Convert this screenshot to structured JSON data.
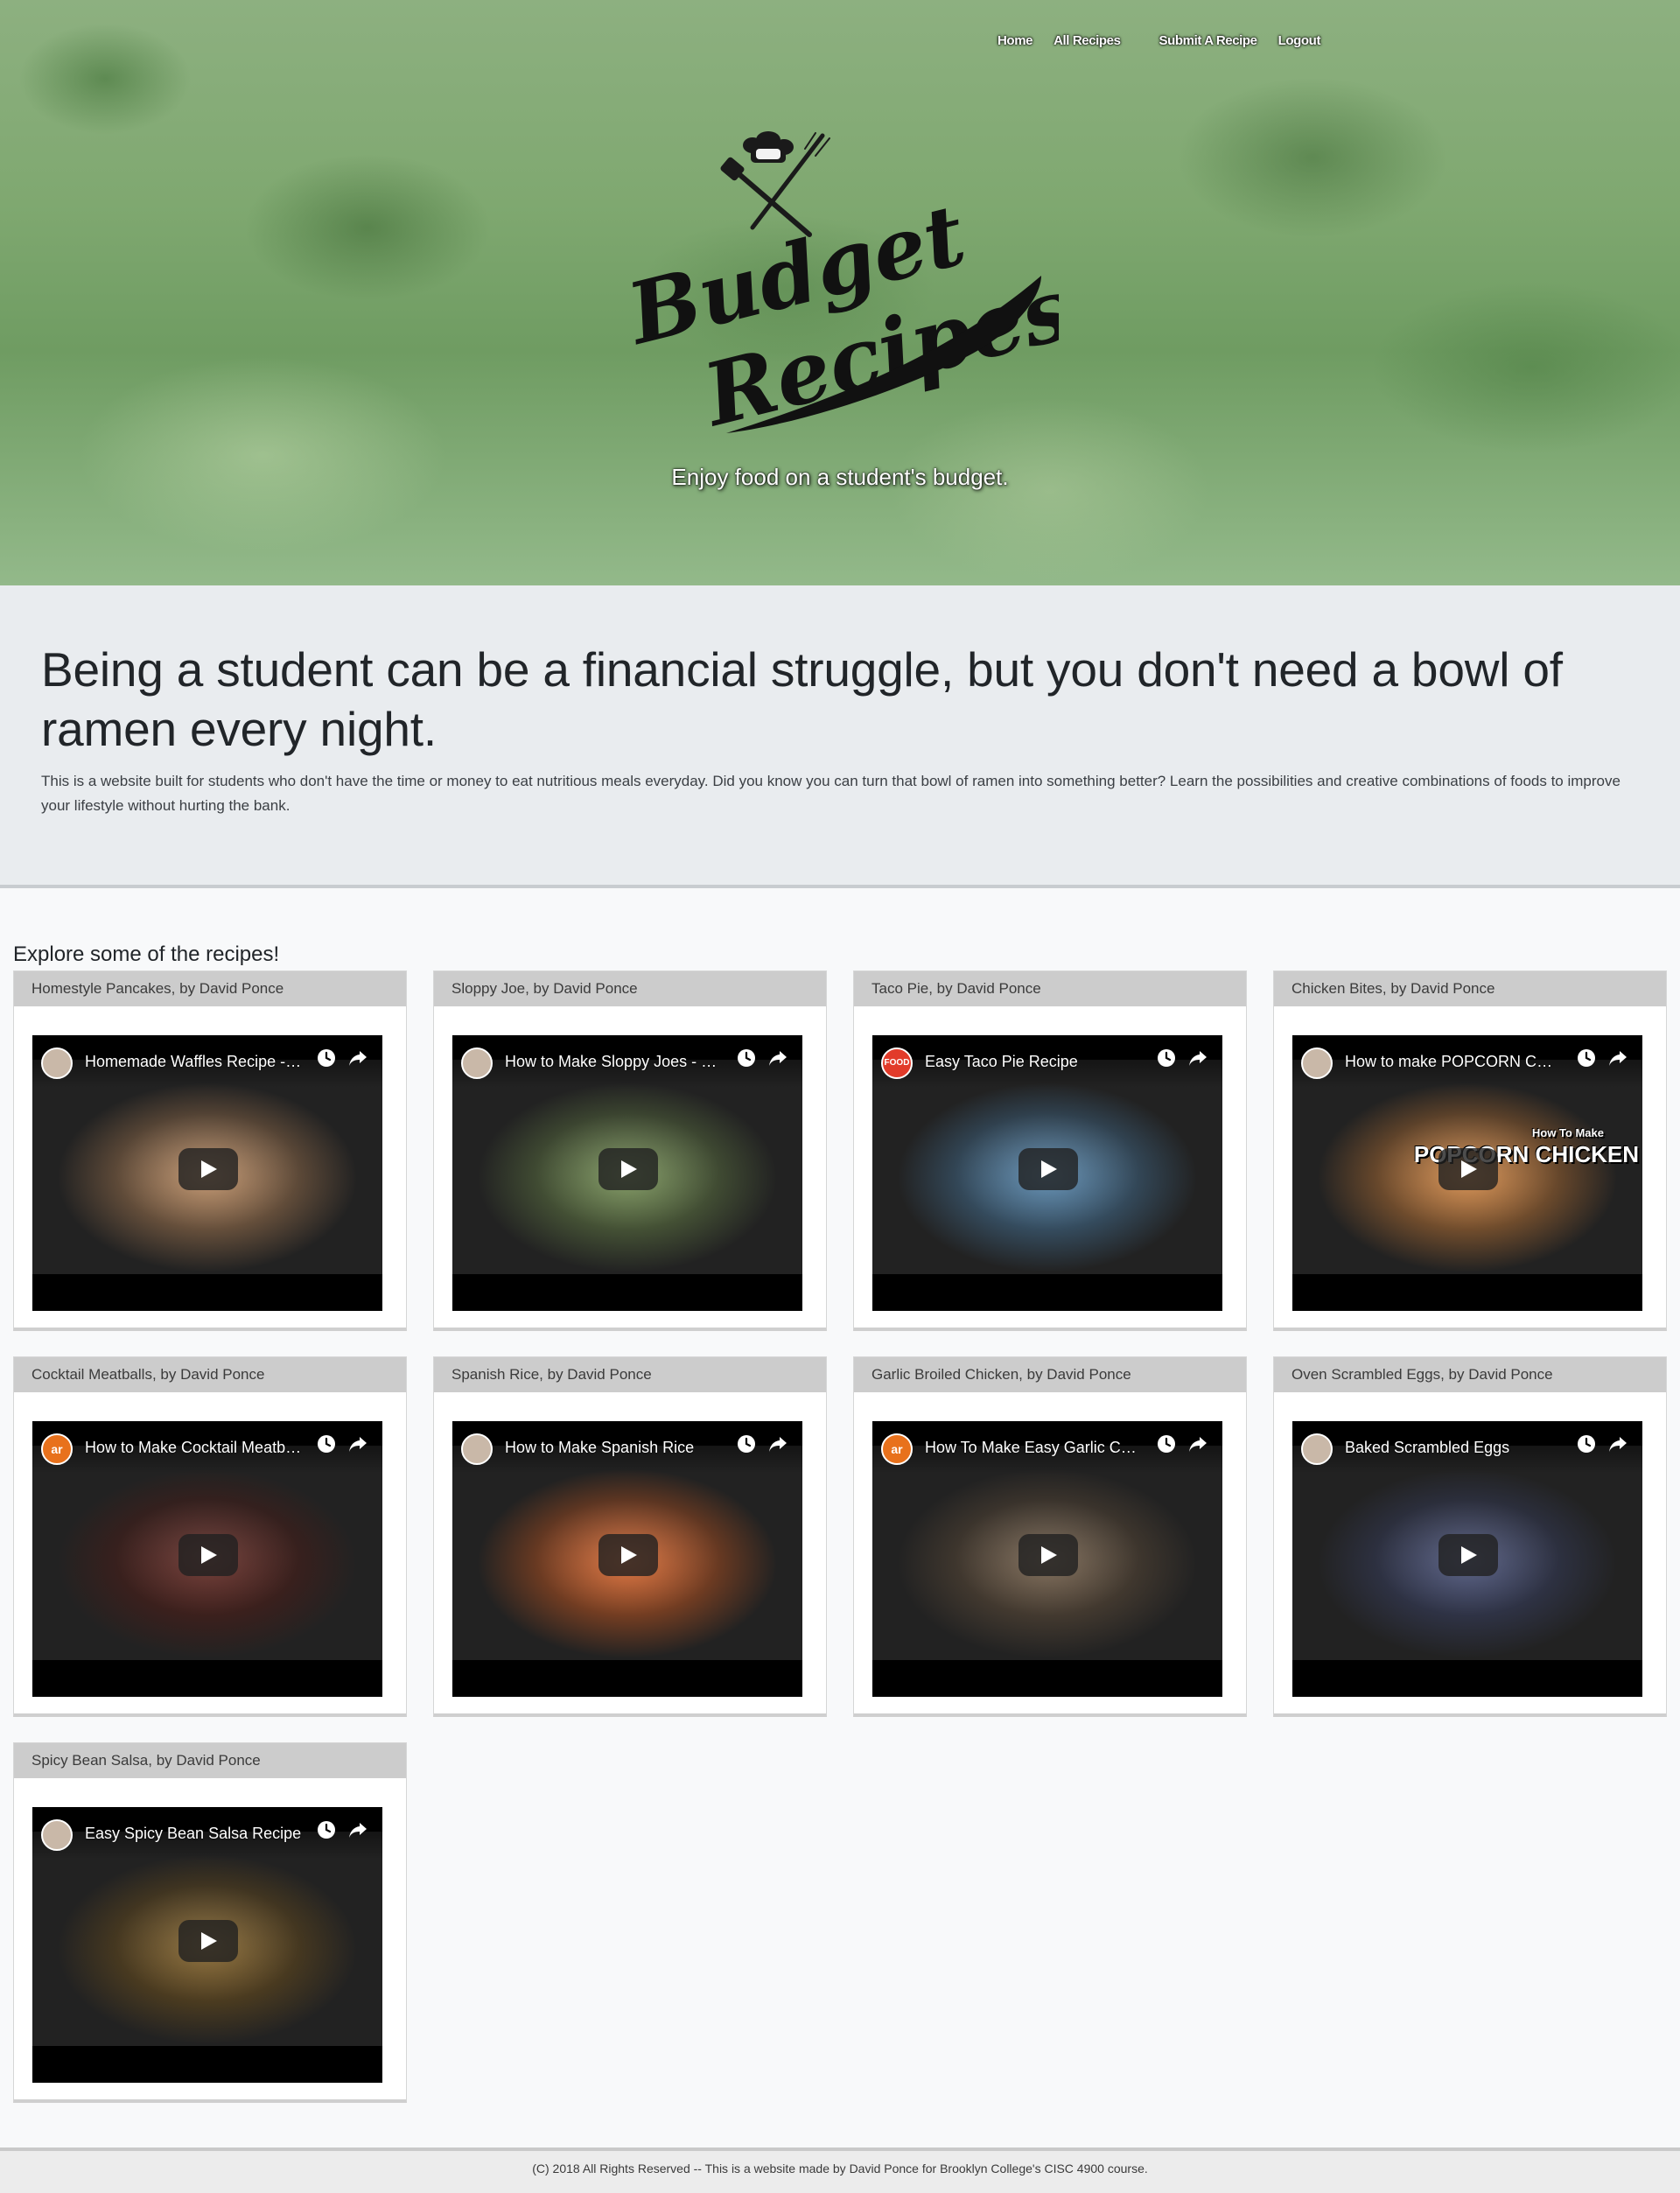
{
  "nav": {
    "items": [
      {
        "label": "Home"
      },
      {
        "label": "All Recipes"
      },
      {
        "label": "Submit A Recipe"
      },
      {
        "label": "Logout"
      }
    ]
  },
  "hero": {
    "logo_text": "Budget Recipes",
    "tagline": "Enjoy food on a student's budget."
  },
  "intro": {
    "heading": "Being a student can be a financial struggle, but you don't need a bowl of ramen every night.",
    "body": "This is a website built for students who don't have the time or money to eat nutritious meals everyday. Did you know you can turn that bowl of ramen into something better? Learn the possibilities and creative combinations of foods to improve your lifestyle without hurting the bank."
  },
  "recipes": {
    "title": "Explore some of the recipes!",
    "cards": [
      {
        "heading": "Homestyle Pancakes, by David Ponce",
        "video_title": "Homemade Waffles Recipe - L...",
        "channel": "",
        "thumb_color": "#b8865a"
      },
      {
        "heading": "Sloppy Joe, by David Ponce",
        "video_title": "How to Make Sloppy Joes - Fo...",
        "channel": "",
        "thumb_color": "#6e8a4c"
      },
      {
        "heading": "Taco Pie, by David Ponce",
        "video_title": "Easy Taco Pie Recipe",
        "channel": "FOOD",
        "thumb_color": "#4c7fa8"
      },
      {
        "heading": "Chicken Bites, by David Ponce",
        "video_title": "How to make POPCORN CHIC...",
        "channel": "",
        "thumb_color": "#d1813a",
        "overlay_small": "How To Make",
        "overlay_big": "POPCORN CHICKEN"
      },
      {
        "heading": "Cocktail Meatballs, by David Ponce",
        "video_title": "How to Make Cocktail Meatba...",
        "channel": "ar",
        "thumb_color": "#5a1d16"
      },
      {
        "heading": "Spanish Rice, by David Ponce",
        "video_title": "How to Make Spanish Rice",
        "channel": "",
        "thumb_color": "#d65e22"
      },
      {
        "heading": "Garlic Broiled Chicken, by David Ponce",
        "video_title": "How To Make Easy Garlic Chi...",
        "channel": "ar",
        "thumb_color": "#6b5640"
      },
      {
        "heading": "Oven Scrambled Eggs, by David Ponce",
        "video_title": "Baked Scrambled Eggs",
        "channel": "",
        "thumb_color": "#3e4770"
      },
      {
        "heading": "Spicy Bean Salsa, by David Ponce",
        "video_title": "Easy Spicy Bean Salsa Recipe",
        "channel": "",
        "thumb_color": "#7d5a1e"
      }
    ]
  },
  "footer": {
    "text": "(C) 2018 All Rights Reserved -- This is a website made by David Ponce for Brooklyn College's CISC 4900 course."
  },
  "colors": {
    "page_bg": "#f8f9fa",
    "jumbotron_bg": "#e9ecef",
    "card_header_bg": "#cccccc"
  }
}
